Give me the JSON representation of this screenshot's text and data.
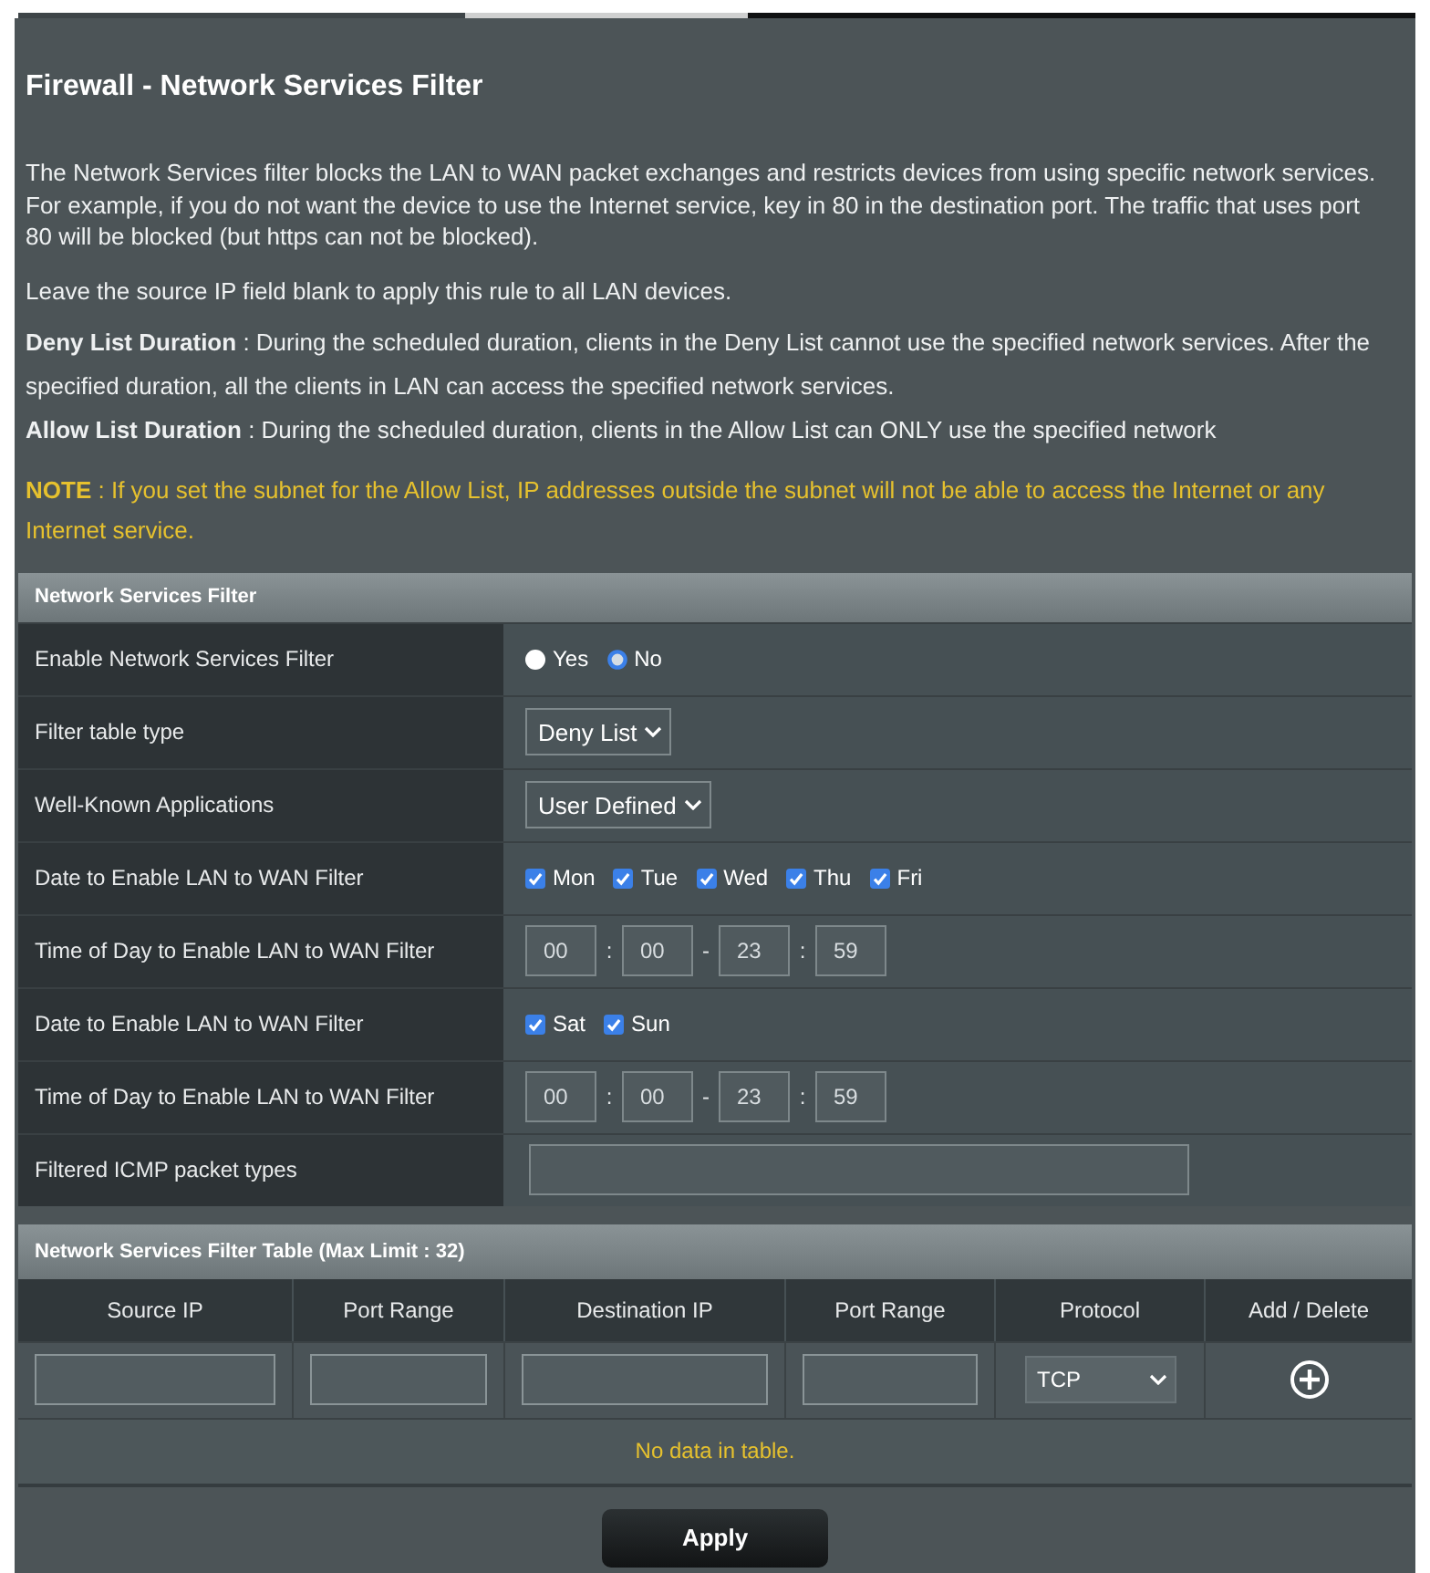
{
  "title": "Firewall - Network Services Filter",
  "description": [
    {
      "kind": "text",
      "paragraphs": [
        "The Network Services filter blocks the LAN to WAN packet exchanges and restricts devices from using specific network services. For example, if you do not want the device to use the Internet service, key in 80 in the destination port. The traffic that uses port 80 will be blocked (but https can not be blocked).",
        "Leave the source IP field blank to apply this rule to all LAN devices."
      ]
    },
    {
      "kind": "text",
      "paragraphs": [
        "**Deny List Duration** : During the scheduled duration, clients in the Deny List cannot use the specified network services. After the specified duration, all the clients in LAN can access the specified network services.",
        "**Allow List Duration** : During the scheduled duration, clients in the Allow List can ONLY use the specified network"
      ]
    },
    {
      "kind": "note",
      "paragraphs": [
        "**NOTE** : If you set the subnet for the Allow List, IP addresses outside the subnet will not be able to access the Internet or any Internet service."
      ]
    }
  ],
  "settings": {
    "title": "Network Services Filter",
    "rows": [
      {
        "kind": "radio",
        "label": "Enable Network Services Filter",
        "options": [
          {
            "label": "Yes",
            "selected": false
          },
          {
            "label": "No",
            "selected": true
          }
        ]
      },
      {
        "kind": "select",
        "label": "Filter table type",
        "value": "Deny List"
      },
      {
        "kind": "select",
        "label": "Well-Known Applications",
        "value": "User Defined"
      },
      {
        "kind": "checkboxes",
        "label": "Date to Enable LAN to WAN Filter",
        "options": [
          {
            "label": "Mon",
            "checked": true
          },
          {
            "label": "Tue",
            "checked": true
          },
          {
            "label": "Wed",
            "checked": true
          },
          {
            "label": "Thu",
            "checked": true
          },
          {
            "label": "Fri",
            "checked": true
          }
        ]
      },
      {
        "kind": "time",
        "label": "Time of Day to Enable LAN to WAN Filter",
        "values": [
          "00",
          "00",
          "23",
          "59"
        ],
        "separators": [
          ":",
          "-",
          ":"
        ]
      },
      {
        "kind": "checkboxes",
        "label": "Date to Enable LAN to WAN Filter",
        "options": [
          {
            "label": "Sat",
            "checked": true
          },
          {
            "label": "Sun",
            "checked": true
          }
        ]
      },
      {
        "kind": "time",
        "label": "Time of Day to Enable LAN to WAN Filter",
        "values": [
          "00",
          "00",
          "23",
          "59"
        ],
        "separators": [
          ":",
          "-",
          ":"
        ]
      },
      {
        "kind": "text_input",
        "label": "Filtered ICMP packet types"
      }
    ]
  },
  "table": {
    "title": "Network Services Filter Table (Max Limit : 32)",
    "columns": [
      "Source IP",
      "Port Range",
      "Destination IP",
      "Port Range",
      "Protocol",
      "Add / Delete"
    ],
    "input_row": [
      {
        "kind": "text_input"
      },
      {
        "kind": "text_input"
      },
      {
        "kind": "text_input"
      },
      {
        "kind": "text_input"
      },
      {
        "kind": "select",
        "value": "TCP"
      },
      {
        "kind": "add"
      }
    ],
    "empty_message": "No data in table."
  },
  "apply_button": "Apply"
}
